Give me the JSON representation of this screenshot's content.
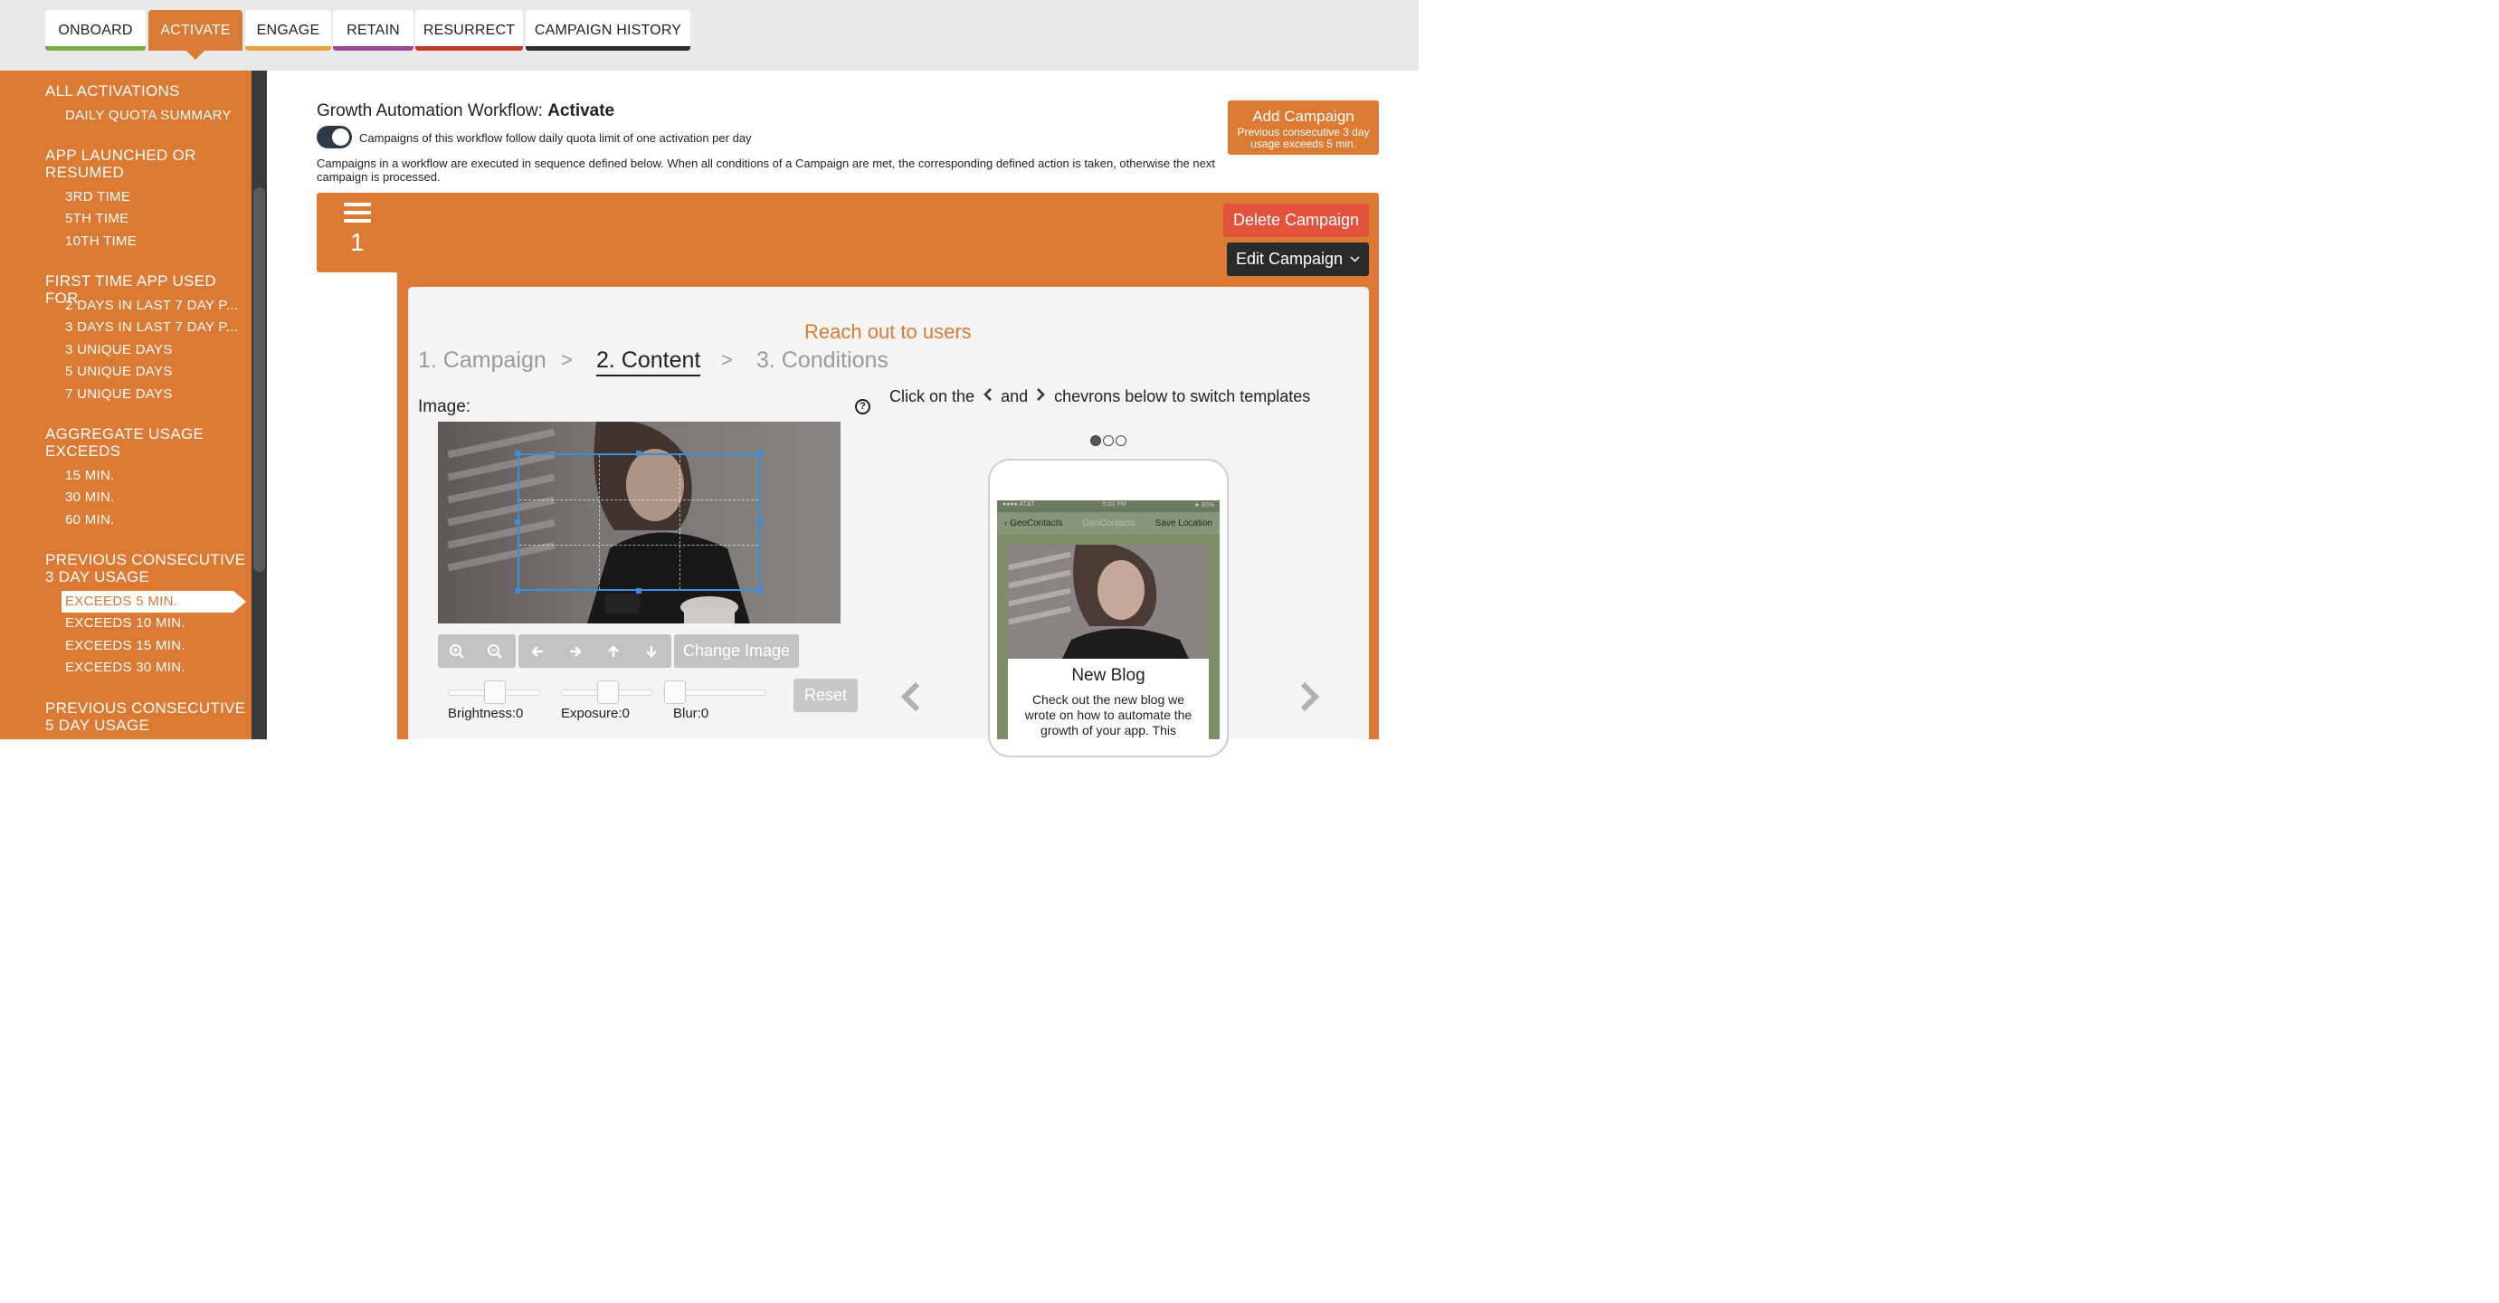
{
  "tabs": [
    {
      "label": "ONBOARD",
      "color": "#7fa944"
    },
    {
      "label": "ACTIVATE",
      "color": "#d97a35"
    },
    {
      "label": "ENGAGE",
      "color": "#e9a23b"
    },
    {
      "label": "RETAIN",
      "color": "#9a4a9c"
    },
    {
      "label": "RESURRECT",
      "color": "#c0392b"
    },
    {
      "label": "CAMPAIGN HISTORY",
      "color": "#2d2d2d"
    }
  ],
  "active_tab": "ACTIVATE",
  "sidebar": {
    "sections": [
      {
        "heading": "ALL ACTIVATIONS",
        "items": [
          "DAILY QUOTA SUMMARY"
        ]
      },
      {
        "heading": "APP LAUNCHED OR RESUMED",
        "items": [
          "3RD TIME",
          "5TH TIME",
          "10TH TIME"
        ]
      },
      {
        "heading": "FIRST TIME APP USED FOR",
        "items": [
          "2 DAYS IN LAST 7 DAY P...",
          "3 DAYS IN LAST 7 DAY P...",
          "3 UNIQUE DAYS",
          "5 UNIQUE DAYS",
          "7 UNIQUE DAYS"
        ]
      },
      {
        "heading": "AGGREGATE USAGE EXCEEDS",
        "items": [
          "15 MIN.",
          "30 MIN.",
          "60 MIN."
        ]
      },
      {
        "heading": "PREVIOUS CONSECUTIVE 3 DAY USAGE",
        "items": [
          "EXCEEDS 5 MIN.",
          "EXCEEDS 10 MIN.",
          "EXCEEDS 15 MIN.",
          "EXCEEDS 30 MIN."
        ]
      },
      {
        "heading": "PREVIOUS CONSECUTIVE 5 DAY USAGE",
        "items": []
      }
    ],
    "selected_item": "EXCEEDS 5 MIN."
  },
  "workflow": {
    "title_prefix": "Growth Automation Workflow:",
    "title_name": "Activate",
    "toggle_on": true,
    "quota_text": "Campaigns of this workflow follow daily quota limit of one activation per day",
    "description": "Campaigns in a workflow are executed in sequence defined below. When all conditions of a Campaign are met, the corresponding defined action is taken, otherwise the next campaign is processed."
  },
  "add_campaign": {
    "label": "Add Campaign",
    "sublabel": "Previous consecutive 3 day usage exceeds 5 min."
  },
  "campaign": {
    "number": "1",
    "delete_label": "Delete Campaign",
    "edit_label": "Edit Campaign",
    "heading": "Reach out to users",
    "steps": [
      "1. Campaign",
      "2. Content",
      "3. Conditions"
    ],
    "active_step": "2. Content",
    "separator": ">",
    "image_label": "Image:",
    "help_icon": "?",
    "change_image_label": "Change Image",
    "reset_label": "Reset",
    "sliders": [
      {
        "label": "Brightness:0",
        "value": 0
      },
      {
        "label": "Exposure:0",
        "value": 0
      },
      {
        "label": "Blur:0",
        "value": 0
      }
    ],
    "switch_text_before": "Click on the",
    "switch_text_mid": "and",
    "switch_text_after": "chevrons below to switch templates",
    "template_index": 1,
    "template_count": 3
  },
  "preview": {
    "status_left": "●●●● AT&T",
    "status_time": "5:01 PM",
    "status_right": "★ 80%",
    "nav_back": "GeoContacts",
    "nav_title": "GeoContacts",
    "nav_action": "Save Location",
    "modal_title": "New Blog",
    "modal_body": "Check out the new blog we wrote on how to automate the growth of your app. This"
  },
  "colors": {
    "accent": "#d97a35",
    "danger": "#e2523d",
    "dark": "#2a2a2a",
    "crop": "#3b8ede"
  },
  "icons": [
    "zoom-in-icon",
    "zoom-out-icon",
    "arrow-left-icon",
    "arrow-right-icon",
    "arrow-up-icon",
    "arrow-down-icon",
    "hamburger-icon",
    "help-icon",
    "chevron-left-icon",
    "chevron-right-icon"
  ]
}
